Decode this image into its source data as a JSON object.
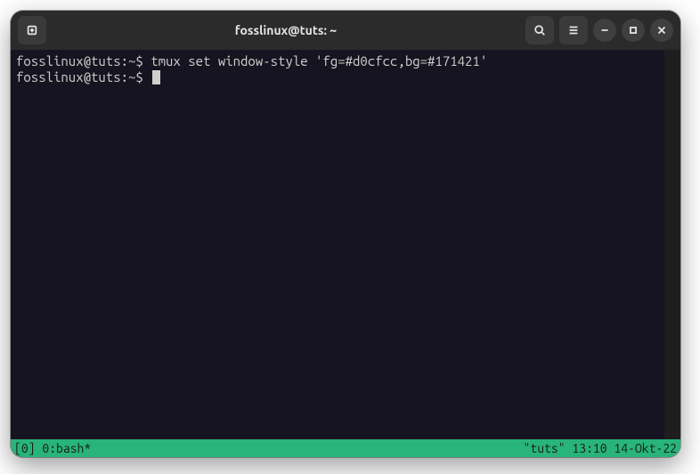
{
  "titlebar": {
    "title": "fosslinux@tuts: ~"
  },
  "terminal": {
    "lines": [
      {
        "prompt": "fosslinux@tuts:~$",
        "command": "tmux set window-style 'fg=#d0cfcc,bg=#171421'"
      },
      {
        "prompt": "fosslinux@tuts:~$",
        "command": ""
      }
    ]
  },
  "statusbar": {
    "left": "[0] 0:bash*",
    "right": "\"tuts\" 13:10 14-Okt-22"
  },
  "colors": {
    "terminal_fg": "#d0cfcc",
    "terminal_bg": "#171421",
    "status_bg": "#28b47a"
  }
}
